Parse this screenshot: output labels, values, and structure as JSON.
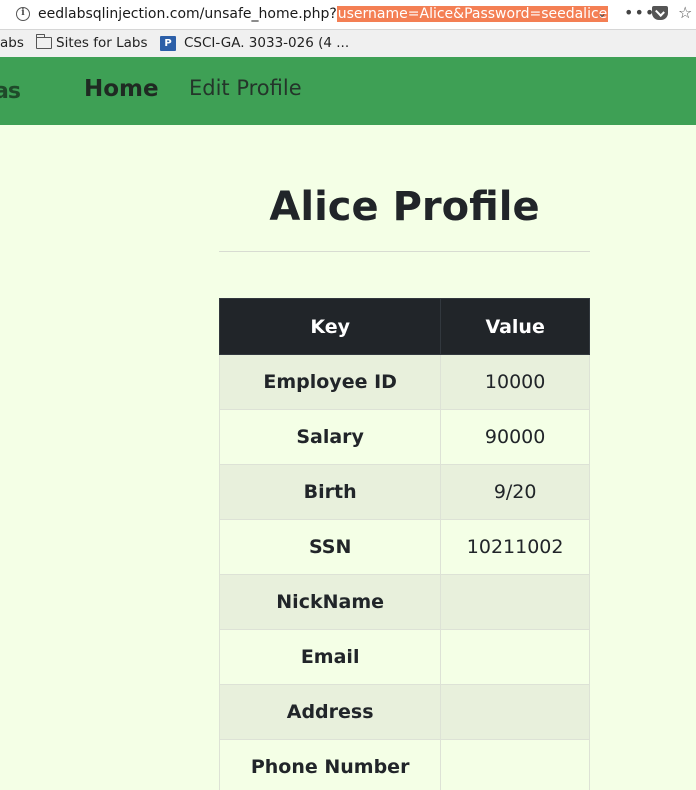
{
  "browser": {
    "url_prefix": "eedlabsqlinjection.com/unsafe_home.php?",
    "url_query": "username=Alice&Password=seedalice",
    "dropdown_glyph": "⌄",
    "more_glyph": "•••",
    "star_glyph": "☆",
    "icons": [
      "info-icon",
      "pocket-icon",
      "star-icon"
    ]
  },
  "bookmarks": [
    {
      "label": "abs"
    },
    {
      "label": "Sites for Labs"
    },
    {
      "label": "CSCI-GA. 3033-026 (4 ..."
    }
  ],
  "navbar": {
    "brand_fragment": "as",
    "home": "Home",
    "edit_profile": "Edit Profile",
    "color": "#3ea055"
  },
  "profile": {
    "title": "Alice Profile",
    "headers": {
      "key": "Key",
      "value": "Value"
    },
    "rows": [
      {
        "key": "Employee ID",
        "value": "10000"
      },
      {
        "key": "Salary",
        "value": "90000"
      },
      {
        "key": "Birth",
        "value": "9/20"
      },
      {
        "key": "SSN",
        "value": "10211002"
      },
      {
        "key": "NickName",
        "value": ""
      },
      {
        "key": "Email",
        "value": ""
      },
      {
        "key": "Address",
        "value": ""
      },
      {
        "key": "Phone Number",
        "value": ""
      }
    ]
  }
}
